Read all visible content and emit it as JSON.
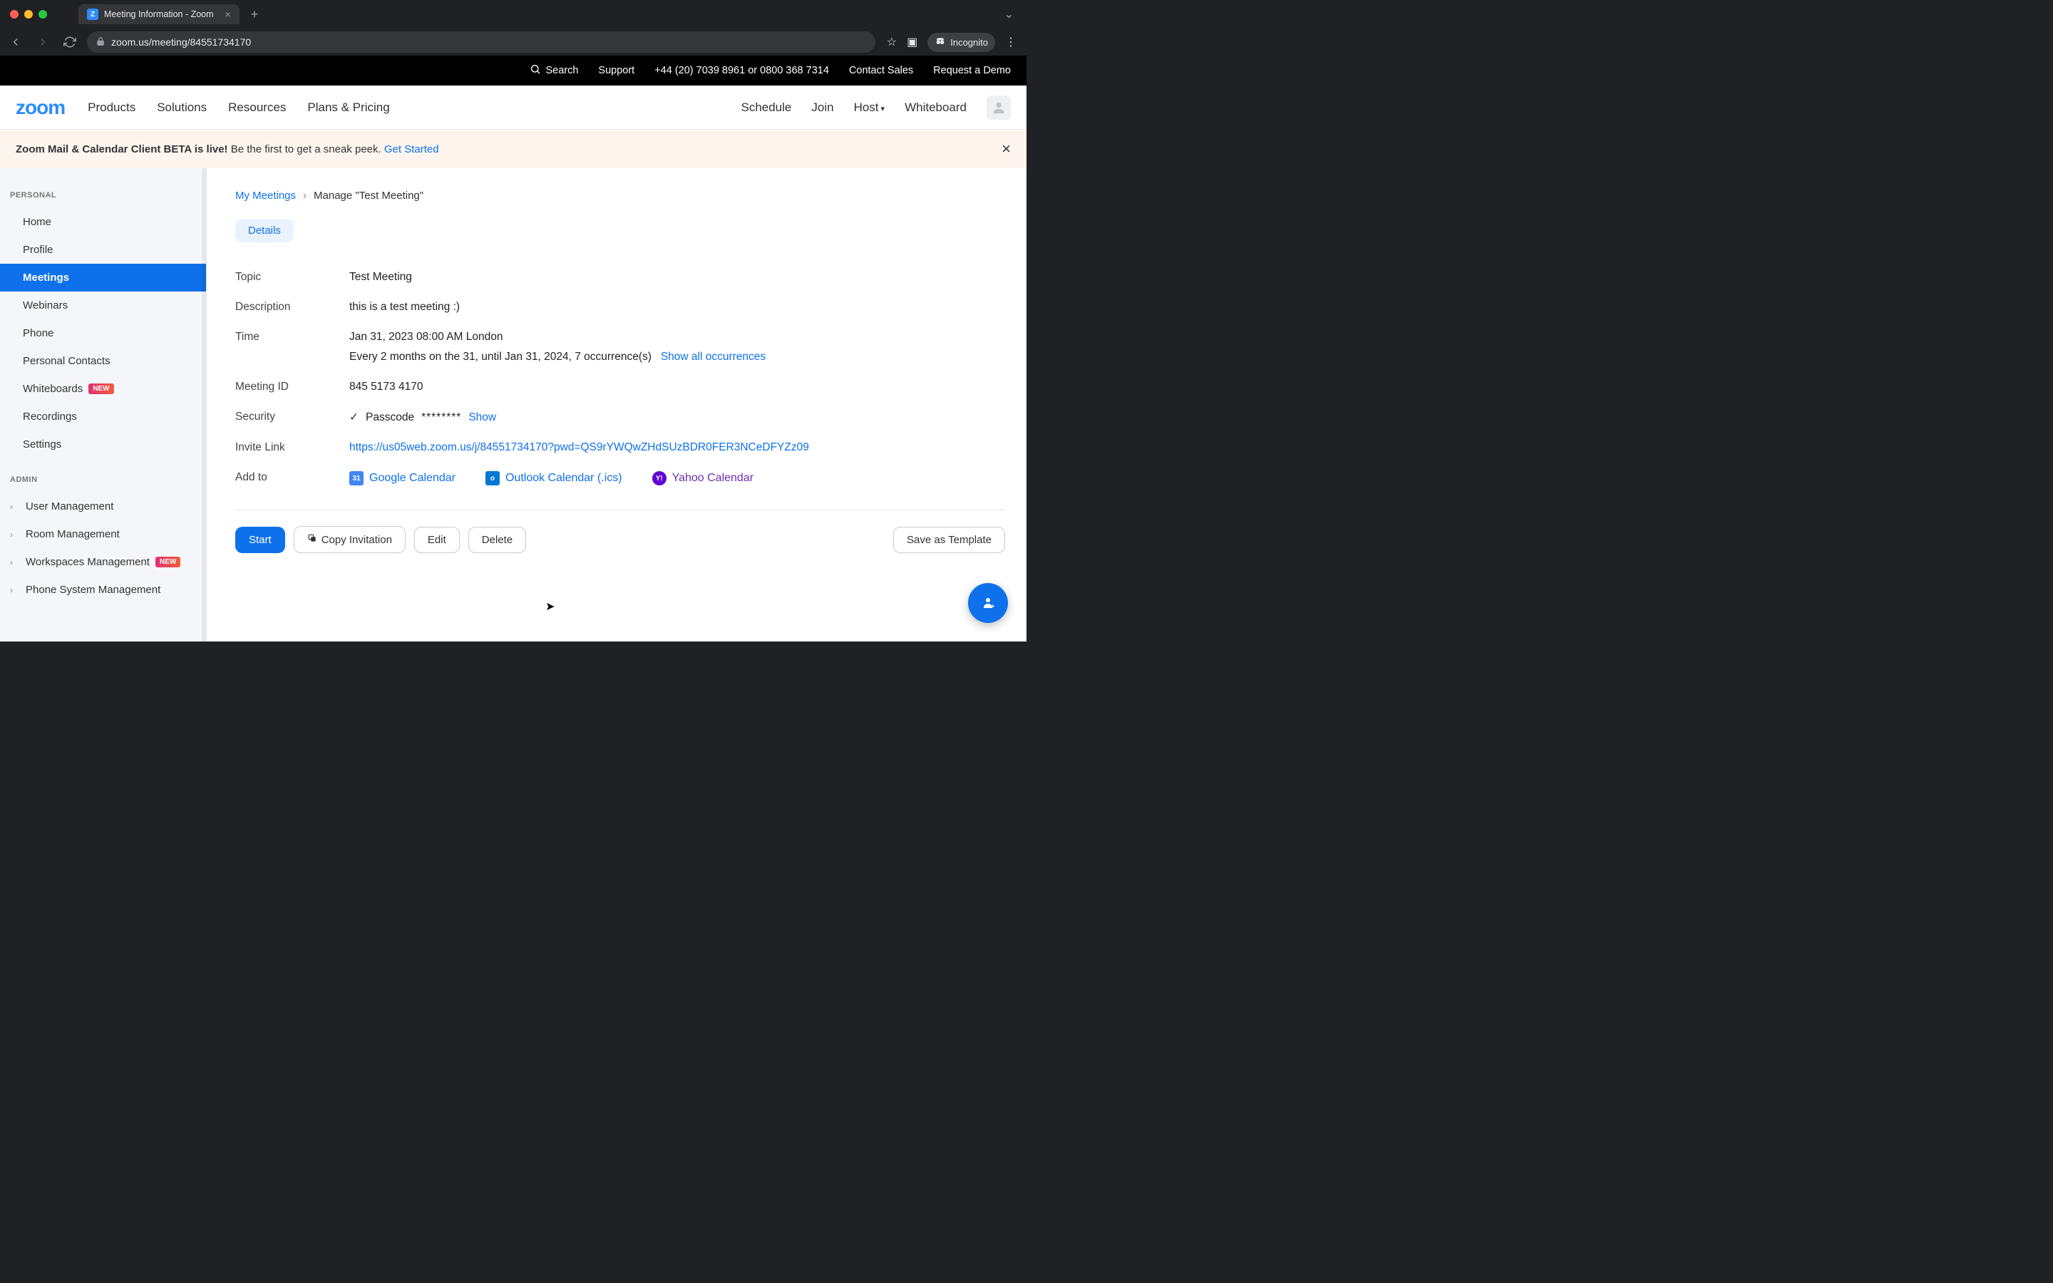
{
  "browser": {
    "tab_title": "Meeting Information - Zoom",
    "url": "zoom.us/meeting/84551734170",
    "incognito_label": "Incognito"
  },
  "utility_bar": {
    "search": "Search",
    "support": "Support",
    "phone": "+44 (20) 7039 8961 or 0800 368 7314",
    "contact_sales": "Contact Sales",
    "request_demo": "Request a Demo"
  },
  "nav": {
    "logo": "zoom",
    "products": "Products",
    "solutions": "Solutions",
    "resources": "Resources",
    "plans": "Plans & Pricing",
    "schedule": "Schedule",
    "join": "Join",
    "host": "Host",
    "whiteboard": "Whiteboard"
  },
  "banner": {
    "bold": "Zoom Mail & Calendar Client BETA is live!",
    "text": " Be the first to get a sneak peek. ",
    "link": "Get Started"
  },
  "sidebar": {
    "personal_heading": "PERSONAL",
    "admin_heading": "ADMIN",
    "items": {
      "home": "Home",
      "profile": "Profile",
      "meetings": "Meetings",
      "webinars": "Webinars",
      "phone": "Phone",
      "personal_contacts": "Personal Contacts",
      "whiteboards": "Whiteboards",
      "recordings": "Recordings",
      "settings": "Settings",
      "user_mgmt": "User Management",
      "room_mgmt": "Room Management",
      "workspaces_mgmt": "Workspaces Management",
      "phone_sys_mgmt": "Phone System Management"
    },
    "badge_new": "NEW"
  },
  "breadcrumb": {
    "my_meetings": "My Meetings",
    "current": "Manage \"Test Meeting\""
  },
  "tabs": {
    "details": "Details"
  },
  "details": {
    "labels": {
      "topic": "Topic",
      "description": "Description",
      "time": "Time",
      "meeting_id": "Meeting ID",
      "security": "Security",
      "invite_link": "Invite Link",
      "add_to": "Add to"
    },
    "topic": "Test Meeting",
    "description": "this is a test meeting :)",
    "time_main": "Jan 31, 2023 08:00 AM London",
    "time_recur": "Every 2 months on the 31, until Jan 31, 2024, 7 occurrence(s)",
    "show_occurrences": "Show all occurrences",
    "meeting_id": "845 5173 4170",
    "passcode_label": "Passcode",
    "passcode_masked": "********",
    "show": "Show",
    "invite_link": "https://us05web.zoom.us/j/84551734170?pwd=QS9rYWQwZHdSUzBDR0FER3NCeDFYZz09",
    "google_cal": "Google Calendar",
    "outlook_cal": "Outlook Calendar (.ics)",
    "yahoo_cal": "Yahoo Calendar"
  },
  "actions": {
    "start": "Start",
    "copy": "Copy Invitation",
    "edit": "Edit",
    "delete": "Delete",
    "save_template": "Save as Template"
  }
}
